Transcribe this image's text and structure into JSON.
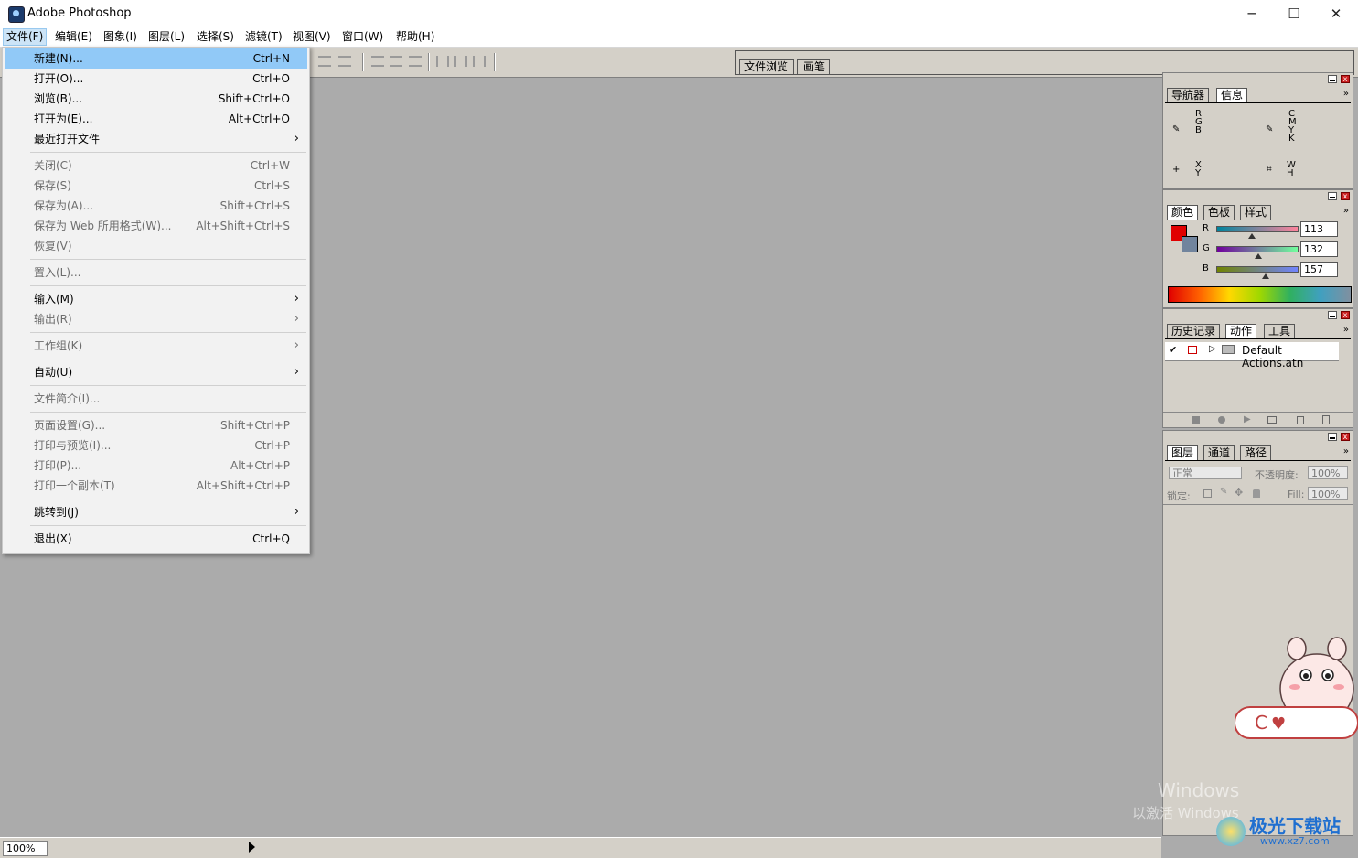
{
  "window": {
    "title": "Adobe Photoshop",
    "minimize_glyph": "─",
    "maximize_glyph": "☐",
    "close_glyph": "✕"
  },
  "menubar": {
    "items": [
      "文件(F)",
      "编辑(E)",
      "图象(I)",
      "图层(L)",
      "选择(S)",
      "滤镜(T)",
      "视图(V)",
      "窗口(W)",
      "帮助(H)"
    ],
    "active": "文件(F)"
  },
  "file_menu": {
    "items": [
      {
        "label": "新建(N)...",
        "shortcut": "Ctrl+N",
        "enabled": true,
        "highlighted": true
      },
      {
        "label": "打开(O)...",
        "shortcut": "Ctrl+O",
        "enabled": true
      },
      {
        "label": "浏览(B)...",
        "shortcut": "Shift+Ctrl+O",
        "enabled": true
      },
      {
        "label": "打开为(E)...",
        "shortcut": "Alt+Ctrl+O",
        "enabled": true
      },
      {
        "label": "最近打开文件",
        "submenu": true,
        "enabled": true
      },
      {
        "label": "关闭(C)",
        "shortcut": "Ctrl+W",
        "enabled": false
      },
      {
        "label": "保存(S)",
        "shortcut": "Ctrl+S",
        "enabled": false
      },
      {
        "label": "保存为(A)...",
        "shortcut": "Shift+Ctrl+S",
        "enabled": false
      },
      {
        "label": "保存为 Web 所用格式(W)...",
        "shortcut": "Alt+Shift+Ctrl+S",
        "enabled": false
      },
      {
        "label": "恢复(V)",
        "enabled": false
      },
      {
        "label": "置入(L)...",
        "enabled": false
      },
      {
        "label": "输入(M)",
        "submenu": true,
        "enabled": true
      },
      {
        "label": "输出(R)",
        "submenu": true,
        "enabled": false
      },
      {
        "label": "工作组(K)",
        "submenu": true,
        "enabled": false
      },
      {
        "label": "自动(U)",
        "submenu": true,
        "enabled": true
      },
      {
        "label": "文件简介(I)...",
        "enabled": false
      },
      {
        "label": "页面设置(G)...",
        "shortcut": "Shift+Ctrl+P",
        "enabled": false
      },
      {
        "label": "打印与预览(I)...",
        "shortcut": "Ctrl+P",
        "enabled": false
      },
      {
        "label": "打印(P)...",
        "shortcut": "Alt+Ctrl+P",
        "enabled": false
      },
      {
        "label": "打印一个副本(T)",
        "shortcut": "Alt+Shift+Ctrl+P",
        "enabled": false
      },
      {
        "label": "跳转到(J)",
        "submenu": true,
        "enabled": true
      },
      {
        "label": "退出(X)",
        "shortcut": "Ctrl+Q",
        "enabled": true
      }
    ],
    "submenu_glyph": "›"
  },
  "palette_well": {
    "tabs": [
      "文件浏览",
      "画笔"
    ]
  },
  "status": {
    "zoom": "100%"
  },
  "info_panel": {
    "tabs": [
      "导航器",
      "信息"
    ],
    "rgb_labels": [
      "R",
      "G",
      "B"
    ],
    "cmyk_labels": [
      "C",
      "M",
      "Y",
      "K"
    ],
    "xy_labels": [
      "X",
      "Y"
    ],
    "wh_labels": [
      "W",
      "H"
    ]
  },
  "color_panel": {
    "tabs": [
      "颜色",
      "色板",
      "样式"
    ],
    "channels": [
      {
        "label": "R",
        "value": "113",
        "level": 0.443
      },
      {
        "label": "G",
        "value": "132",
        "level": 0.518
      },
      {
        "label": "B",
        "value": "157",
        "level": 0.616
      }
    ],
    "foreground": "#e00000",
    "background": "#71849d"
  },
  "actions_panel": {
    "tabs": [
      "历史记录",
      "动作",
      "工具"
    ],
    "set_name": "Default Actions.atn"
  },
  "layers_panel": {
    "tabs": [
      "图层",
      "通道",
      "路径"
    ],
    "blend_mode": "正常",
    "opacity_label": "不透明度:",
    "opacity_value": "100%",
    "lock_label": "锁定:",
    "fill_label": "Fill:",
    "fill_value": "100%"
  },
  "overlay": {
    "watermark_line1": "Windows",
    "watermark_line2": "以激活 Windows",
    "site_logo": "极光下载站",
    "site_url": "www.xz7.com"
  },
  "colors": {
    "annotation_arrow": "#e02020",
    "menu_highlight": "#91c9f7",
    "canvas": "#ababab"
  }
}
